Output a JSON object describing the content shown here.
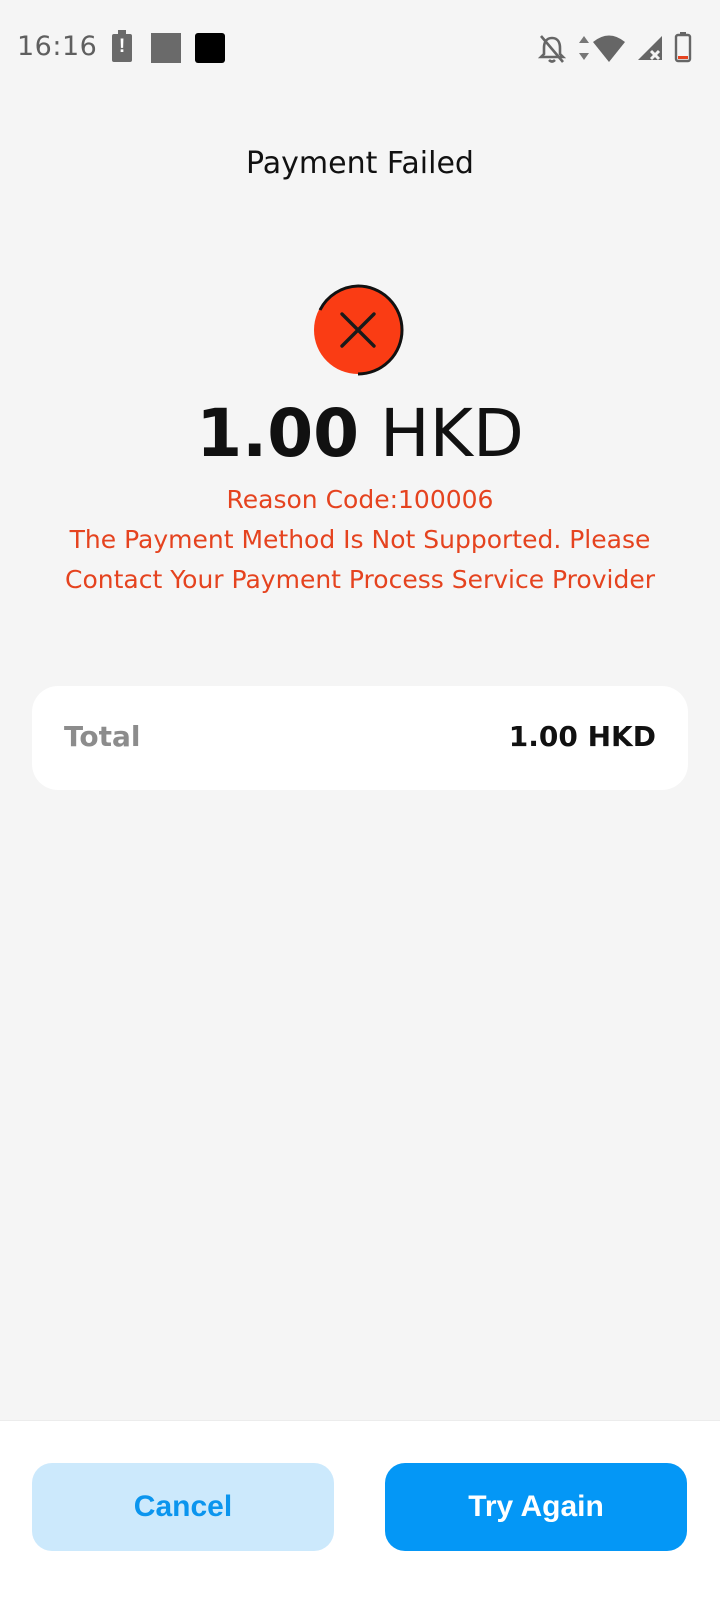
{
  "status_bar": {
    "time": "16:16",
    "alert_glyph": "!",
    "icons": [
      "battery-alert-icon",
      "notification-gray-square-icon",
      "notification-black-square-icon",
      "bell-off-icon",
      "data-arrows-icon",
      "wifi-icon",
      "signal-no-service-icon",
      "battery-icon"
    ]
  },
  "header": {
    "title": "Payment Failed"
  },
  "result": {
    "icon": "error-x-icon",
    "icon_color": "#fa3c14",
    "amount": "1.00",
    "currency": "HKD",
    "reason_code": "Reason Code:100006",
    "message_line1": "The Payment Method Is Not Supported. Please",
    "message_line2": "Contact Your Payment Process Service Provider",
    "error_color": "#e5431f"
  },
  "summary": {
    "total_label": "Total",
    "total_value": "1.00 HKD"
  },
  "actions": {
    "cancel_label": "Cancel",
    "try_again_label": "Try Again",
    "primary_color": "#0497f6",
    "secondary_bg": "#cce9fc"
  }
}
